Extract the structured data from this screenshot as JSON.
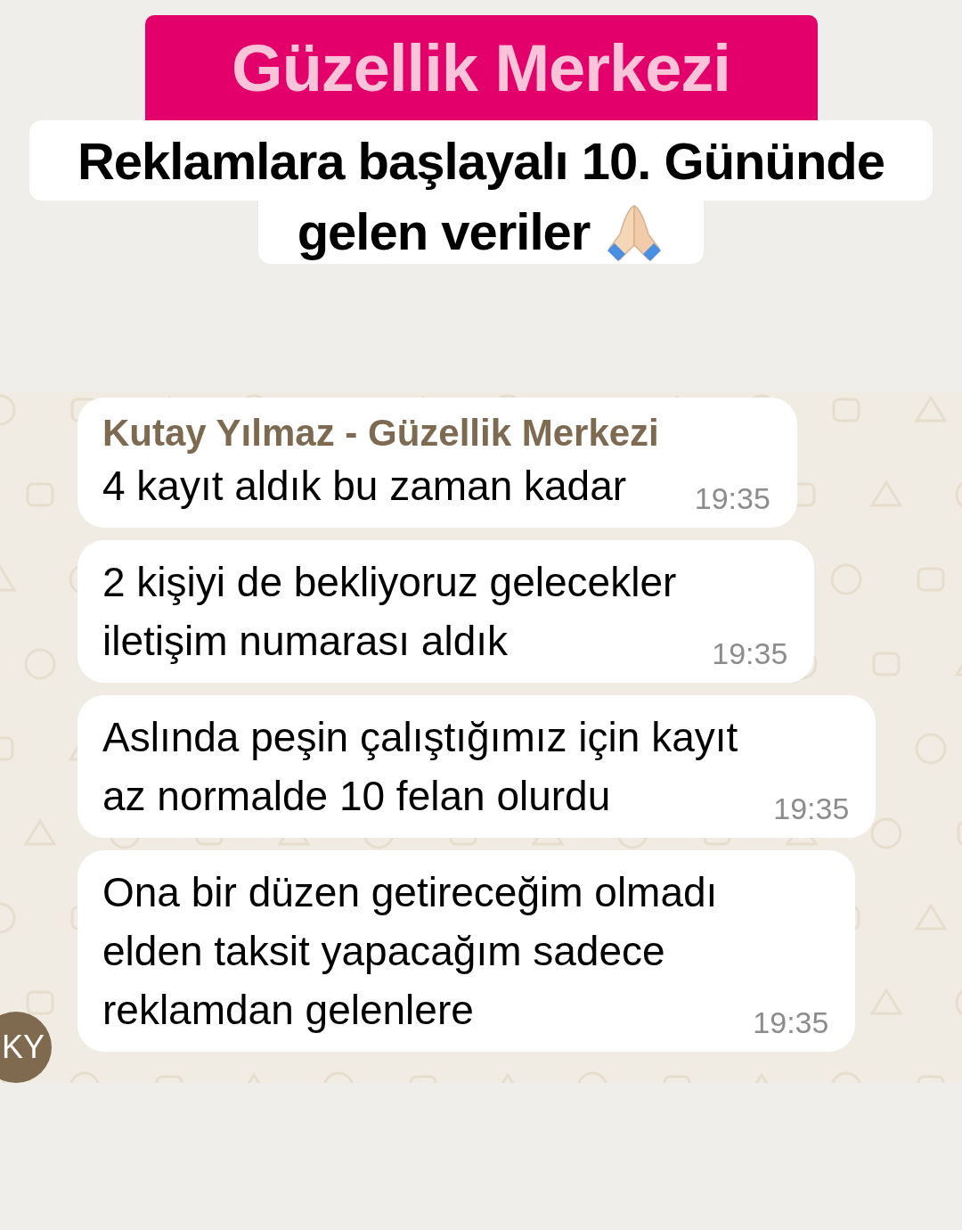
{
  "banner": {
    "title": "Güzellik Merkezi",
    "subtitle_lines": [
      "Reklamlara başlayalı 10. Gününde",
      "gelen veriler"
    ]
  },
  "chat": {
    "avatar": "KY",
    "messages": [
      {
        "sender": "Kutay Yılmaz - Güzellik Merkezi",
        "lines": [
          "4 kayıt aldık bu zaman kadar"
        ],
        "time": "19:35"
      },
      {
        "lines": [
          "2 kişiyi de bekliyoruz gelecekler",
          "iletişim numarası aldık"
        ],
        "time": "19:35"
      },
      {
        "lines": [
          "Aslında peşin çalıştığımız için kayıt",
          "az normalde 10 felan olurdu"
        ],
        "time": "19:35"
      },
      {
        "lines": [
          "Ona bir düzen getireceğim olmadı",
          "elden taksit yapacağım sadece",
          "reklamdan gelenlere"
        ],
        "time": "19:35"
      }
    ]
  }
}
